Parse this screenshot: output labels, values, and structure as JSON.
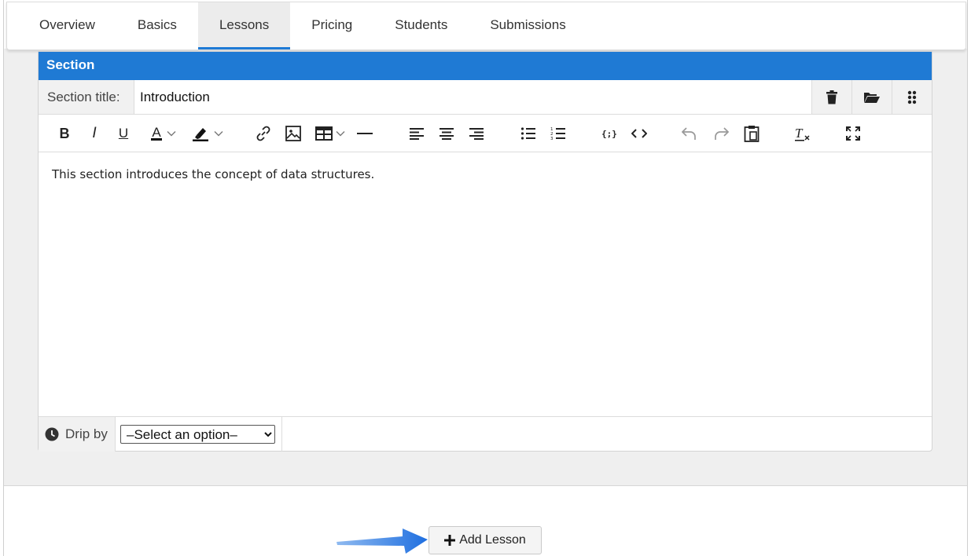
{
  "tabs": [
    {
      "label": "Overview"
    },
    {
      "label": "Basics"
    },
    {
      "label": "Lessons",
      "active": true
    },
    {
      "label": "Pricing"
    },
    {
      "label": "Students"
    },
    {
      "label": "Submissions"
    }
  ],
  "section": {
    "header": "Section",
    "title_label": "Section title:",
    "title_value": "Introduction",
    "actions": [
      "trash-icon",
      "folder-open-icon",
      "drag-handle-icon"
    ]
  },
  "toolbar": {
    "bold": "B",
    "italic": "I",
    "underline": "U",
    "text_color": "A",
    "icons": [
      "link-icon",
      "image-icon",
      "table-icon",
      "horizontal-rule-icon",
      "align-left-icon",
      "align-center-icon",
      "align-right-icon",
      "bullet-list-icon",
      "numbered-list-icon",
      "code-block-icon",
      "source-code-icon",
      "undo-icon",
      "redo-icon",
      "paste-icon",
      "clear-format-icon",
      "fullscreen-icon"
    ]
  },
  "editor": {
    "content": "This section introduces the concept of data structures."
  },
  "drip": {
    "label": "Drip by",
    "selected": "–Select an option–"
  },
  "add_lesson": {
    "label": "Add Lesson"
  },
  "colors": {
    "accent": "#1f7ad4",
    "arrow": "#2a7de1"
  }
}
